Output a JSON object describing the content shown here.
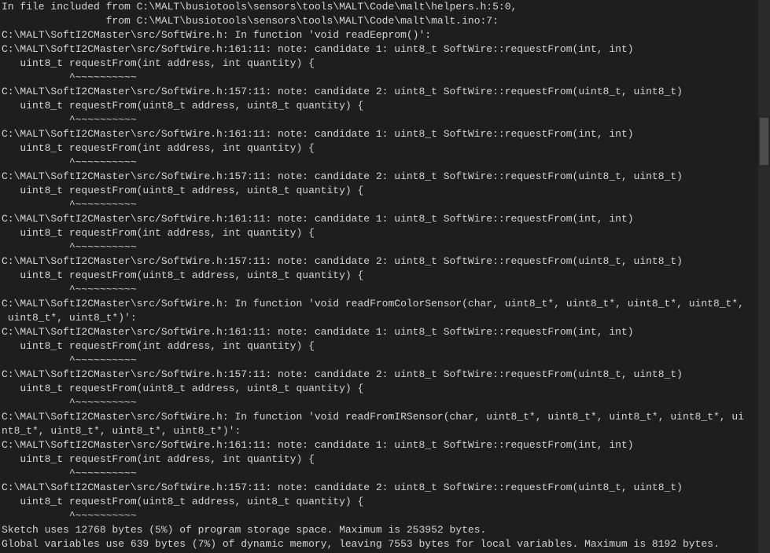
{
  "lines": [
    "In file included from C:\\MALT\\busiotools\\sensors\\tools\\MALT\\Code\\malt\\helpers.h:5:0,",
    "                 from C:\\MALT\\busiotools\\sensors\\tools\\MALT\\Code\\malt\\malt.ino:7:",
    "C:\\MALT\\SoftI2CMaster\\src/SoftWire.h: In function 'void readEeprom()':",
    "C:\\MALT\\SoftI2CMaster\\src/SoftWire.h:161:11: note: candidate 1: uint8_t SoftWire::requestFrom(int, int)",
    "   uint8_t requestFrom(int address, int quantity) {",
    "           ^~~~~~~~~~~",
    "C:\\MALT\\SoftI2CMaster\\src/SoftWire.h:157:11: note: candidate 2: uint8_t SoftWire::requestFrom(uint8_t, uint8_t)",
    "   uint8_t requestFrom(uint8_t address, uint8_t quantity) {",
    "           ^~~~~~~~~~~",
    "C:\\MALT\\SoftI2CMaster\\src/SoftWire.h:161:11: note: candidate 1: uint8_t SoftWire::requestFrom(int, int)",
    "   uint8_t requestFrom(int address, int quantity) {",
    "           ^~~~~~~~~~~",
    "C:\\MALT\\SoftI2CMaster\\src/SoftWire.h:157:11: note: candidate 2: uint8_t SoftWire::requestFrom(uint8_t, uint8_t)",
    "   uint8_t requestFrom(uint8_t address, uint8_t quantity) {",
    "           ^~~~~~~~~~~",
    "C:\\MALT\\SoftI2CMaster\\src/SoftWire.h:161:11: note: candidate 1: uint8_t SoftWire::requestFrom(int, int)",
    "   uint8_t requestFrom(int address, int quantity) {",
    "           ^~~~~~~~~~~",
    "C:\\MALT\\SoftI2CMaster\\src/SoftWire.h:157:11: note: candidate 2: uint8_t SoftWire::requestFrom(uint8_t, uint8_t)",
    "   uint8_t requestFrom(uint8_t address, uint8_t quantity) {",
    "           ^~~~~~~~~~~",
    "C:\\MALT\\SoftI2CMaster\\src/SoftWire.h: In function 'void readFromColorSensor(char, uint8_t*, uint8_t*, uint8_t*, uint8_t*, uint8_t*, uint8_t*)':",
    "C:\\MALT\\SoftI2CMaster\\src/SoftWire.h:161:11: note: candidate 1: uint8_t SoftWire::requestFrom(int, int)",
    "   uint8_t requestFrom(int address, int quantity) {",
    "           ^~~~~~~~~~~",
    "C:\\MALT\\SoftI2CMaster\\src/SoftWire.h:157:11: note: candidate 2: uint8_t SoftWire::requestFrom(uint8_t, uint8_t)",
    "   uint8_t requestFrom(uint8_t address, uint8_t quantity) {",
    "           ^~~~~~~~~~~",
    "C:\\MALT\\SoftI2CMaster\\src/SoftWire.h: In function 'void readFromIRSensor(char, uint8_t*, uint8_t*, uint8_t*, uint8_t*, uint8_t*, uint8_t*, uint8_t*, uint8_t*)':",
    "C:\\MALT\\SoftI2CMaster\\src/SoftWire.h:161:11: note: candidate 1: uint8_t SoftWire::requestFrom(int, int)",
    "   uint8_t requestFrom(int address, int quantity) {",
    "           ^~~~~~~~~~~",
    "C:\\MALT\\SoftI2CMaster\\src/SoftWire.h:157:11: note: candidate 2: uint8_t SoftWire::requestFrom(uint8_t, uint8_t)",
    "   uint8_t requestFrom(uint8_t address, uint8_t quantity) {",
    "           ^~~~~~~~~~~",
    "Sketch uses 12768 bytes (5%) of program storage space. Maximum is 253952 bytes.",
    "Global variables use 639 bytes (7%) of dynamic memory, leaving 7553 bytes for local variables. Maximum is 8192 bytes.",
    ""
  ]
}
